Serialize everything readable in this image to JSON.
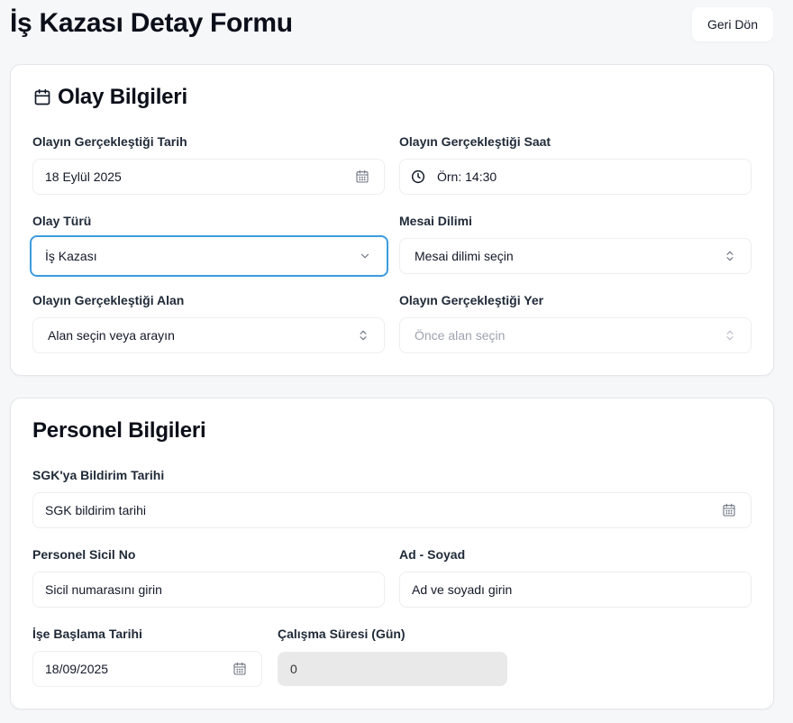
{
  "header": {
    "title": "İş Kazası Detay Formu",
    "back_label": "Geri Dön"
  },
  "olay": {
    "title": "Olay Bilgileri",
    "date_label": "Olayın Gerçekleştiği Tarih",
    "date_value": "18 Eylül 2025",
    "time_label": "Olayın Gerçekleştiği Saat",
    "time_placeholder": "Örn: 14:30",
    "type_label": "Olay Türü",
    "type_value": "İş Kazası",
    "shift_label": "Mesai Dilimi",
    "shift_placeholder": "Mesai dilimi seçin",
    "area_label": "Olayın Gerçekleştiği Alan",
    "area_placeholder": "Alan seçin veya arayın",
    "place_label": "Olayın Gerçekleştiği Yer",
    "place_placeholder": "Önce alan seçin"
  },
  "personel": {
    "title": "Personel Bilgileri",
    "sgk_label": "SGK'ya Bildirim Tarihi",
    "sgk_placeholder": "SGK bildirim tarihi",
    "sicil_label": "Personel Sicil No",
    "sicil_placeholder": "Sicil numarasını girin",
    "name_label": "Ad - Soyad",
    "name_placeholder": "Ad ve soyadı girin",
    "start_label": "İşe Başlama Tarihi",
    "start_value": "18/09/2025",
    "duration_label": "Çalışma Süresi (Gün)",
    "duration_value": "0"
  }
}
